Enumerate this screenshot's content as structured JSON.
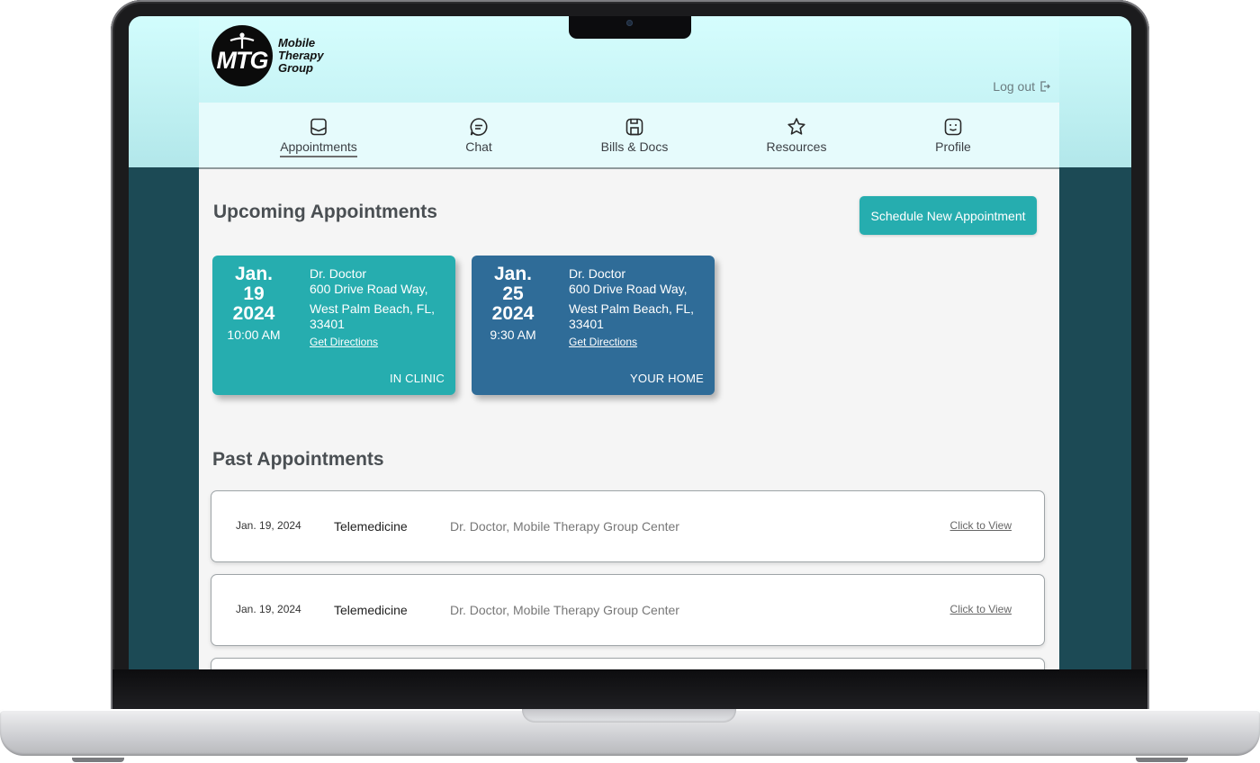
{
  "brand": {
    "logo_letters": "MTG",
    "name_lines": [
      "Mobile",
      "Therapy",
      "Group"
    ]
  },
  "header": {
    "logout_label": "Log out"
  },
  "nav": {
    "active": "Appointments",
    "items": [
      {
        "label": "Appointments",
        "icon": "bookmark-icon"
      },
      {
        "label": "Chat",
        "icon": "chat-bubble-icon"
      },
      {
        "label": "Bills & Docs",
        "icon": "save-icon"
      },
      {
        "label": "Resources",
        "icon": "star-icon"
      },
      {
        "label": "Profile",
        "icon": "smiley-face-icon"
      }
    ]
  },
  "upcoming": {
    "title": "Upcoming Appointments",
    "schedule_button": "Schedule New Appointment",
    "cards": [
      {
        "month": "Jan.",
        "day": "19",
        "year": "2024",
        "time": "10:00 AM",
        "doctor": "Dr. Doctor",
        "address_line1": "600 Drive Road Way,",
        "address_line2": "West Palm Beach, FL, 33401",
        "directions": "Get Directions",
        "location_type": "IN CLINIC",
        "color": "#26adaf"
      },
      {
        "month": "Jan.",
        "day": "25",
        "year": "2024",
        "time": "9:30 AM",
        "doctor": "Dr. Doctor",
        "address_line1": "600 Drive Road Way,",
        "address_line2": "West Palm Beach, FL, 33401",
        "directions": "Get Directions",
        "location_type": "YOUR HOME",
        "color": "#2f6c98"
      }
    ]
  },
  "past": {
    "title": "Past Appointments",
    "rows": [
      {
        "date": "Jan. 19, 2024",
        "type": "Telemedicine",
        "provider": "Dr. Doctor, Mobile Therapy Group Center",
        "action": "Click to View"
      },
      {
        "date": "Jan. 19, 2024",
        "type": "Telemedicine",
        "provider": "Dr. Doctor, Mobile Therapy Group Center",
        "action": "Click to View"
      }
    ]
  },
  "colors": {
    "accent_teal": "#26adaf",
    "accent_blue": "#2f6c98",
    "backdrop": "#1c4a55",
    "header_cyan": "#d2fdfd"
  }
}
